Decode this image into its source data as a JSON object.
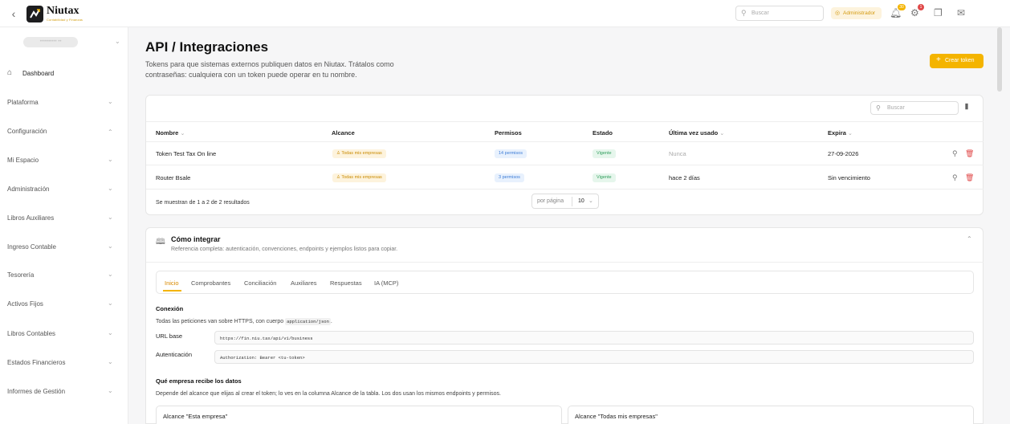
{
  "topbar": {
    "back_icon": "‹",
    "logo_name": "Niutax",
    "logo_sub": "Contabilidad y Finanzas",
    "search_placeholder": "Buscar",
    "admin_label": "Administrador",
    "notif_count": "30",
    "tasks_count": "1",
    "colors": {
      "accent": "#f4b400",
      "badge_blue": "#f4b400",
      "badge_red": "#e04848"
    }
  },
  "sidebar": {
    "company": "•••••••••• ••",
    "items": [
      {
        "label": "Dashboard"
      },
      {
        "label": "Plataforma"
      },
      {
        "label": "Configuración"
      },
      {
        "label": "Mi Espacio"
      },
      {
        "label": "Administración"
      },
      {
        "label": "Libros Auxiliares"
      },
      {
        "label": "Ingreso Contable"
      },
      {
        "label": "Tesorería"
      },
      {
        "label": "Activos Fijos"
      },
      {
        "label": "Libros Contables"
      },
      {
        "label": "Estados Financieros"
      },
      {
        "label": "Informes de Gestión"
      }
    ]
  },
  "page": {
    "title": "API / Integraciones",
    "subtitle": "Tokens para que sistemas externos publiquen datos en Niutax. Trátalos como contraseñas: cualquiera con un token puede operar en tu nombre.",
    "create_button": "Crear token"
  },
  "table": {
    "search_placeholder": "Buscar",
    "columns": [
      "Nombre",
      "Alcance",
      "Permisos",
      "Estado",
      "Última vez usado",
      "Expira"
    ],
    "rows": [
      {
        "name": "Token Test Tax On line",
        "scope": "Todas mis empresas",
        "perms": "14 permisos",
        "status": "Vigente",
        "last_used": "Nunca",
        "expires": "27-09-2026"
      },
      {
        "name": "Router Bsale",
        "scope": "Todas mis empresas",
        "perms": "3 permisos",
        "status": "Vigente",
        "last_used": "hace 2 días",
        "expires": "Sin vencimiento"
      }
    ],
    "footer": "Se muestran de 1 a 2 de 2 resultados",
    "per_page_label": "por página",
    "per_page_value": "10"
  },
  "integration": {
    "title": "Cómo integrar",
    "subtitle": "Referencia completa: autenticación, convenciones, endpoints y ejemplos listos para copiar.",
    "tabs": [
      "Inicio",
      "Comprobantes",
      "Conciliación",
      "Auxiliares",
      "Respuestas",
      "IA (MCP)"
    ],
    "connection_title": "Conexión",
    "connection_text_pre": "Todas las peticiones van sobre HTTPS, con cuerpo",
    "connection_code": "application/json",
    "connection_text_post": ".",
    "base_url_label": "URL base",
    "base_url_value": "https://fin.niu.tax/api/v1/business",
    "auth_label": "Autenticación",
    "auth_value": "Authorization: Bearer <tu-token>",
    "company_title": "Qué empresa recibe los datos",
    "company_text": "Depende del alcance que elijas al crear el token; lo ves en la columna Alcance de la tabla. Los dos usan los mismos endpoints y permisos.",
    "scope_one": "Alcance \"Esta empresa\"",
    "scope_all": "Alcance \"Todas mis empresas\""
  }
}
